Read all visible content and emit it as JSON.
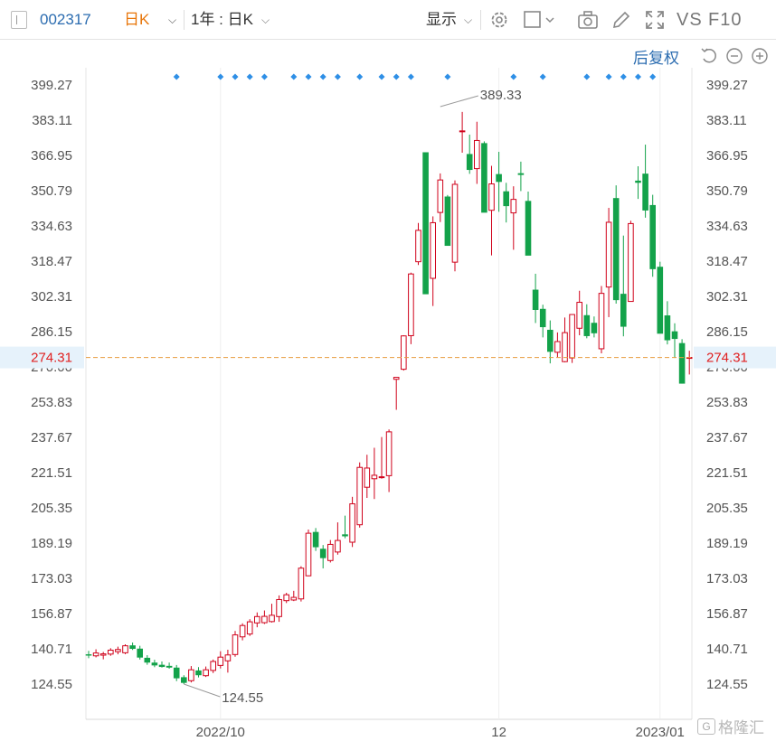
{
  "toolbar": {
    "stock_code": "002317",
    "period": "日K",
    "range": "1年 : 日K",
    "display": "显示",
    "vs": "VS",
    "f10": "F10",
    "adjust": "后复权"
  },
  "watermark": "格隆汇",
  "colors": {
    "up": "#d0021b",
    "down": "#13a24a",
    "price_line": "#e89b3c",
    "price_label_bg": "#e6f2fb",
    "price_label_text": "#e02020",
    "dot": "#2e8fe6"
  },
  "chart_data": {
    "type": "candlestick",
    "y_ticks": [
      "399.27",
      "383.11",
      "366.95",
      "350.79",
      "334.63",
      "318.47",
      "302.31",
      "286.15",
      "270.00",
      "253.83",
      "237.67",
      "221.51",
      "205.35",
      "189.19",
      "173.03",
      "156.87",
      "140.71",
      "124.55"
    ],
    "ylim": [
      116.47,
      407.35
    ],
    "x_tick_labels": [
      {
        "label": "2022/10",
        "index": 18
      },
      {
        "label": "12",
        "index": 56
      },
      {
        "label": "2023/01",
        "index": 78
      }
    ],
    "current_price": "274.31",
    "annotations": [
      {
        "label": "389.33",
        "index": 48,
        "value": 389.33,
        "side": "right"
      },
      {
        "label": "124.55",
        "index": 13,
        "value": 124.55,
        "side": "right-below"
      }
    ],
    "event_dot_indices": [
      12,
      18,
      20,
      22,
      24,
      28,
      30,
      32,
      34,
      37,
      40,
      42,
      44,
      49,
      58,
      62,
      68,
      71,
      73,
      75,
      77
    ],
    "candles": [
      {
        "o": 138.2,
        "h": 139.8,
        "l": 136.4,
        "c": 137.6
      },
      {
        "o": 137.5,
        "h": 140.5,
        "l": 136.8,
        "c": 138.8
      },
      {
        "o": 137.8,
        "h": 139.3,
        "l": 135.9,
        "c": 138.4
      },
      {
        "o": 138.3,
        "h": 141.0,
        "l": 137.5,
        "c": 140.1
      },
      {
        "o": 139.4,
        "h": 141.7,
        "l": 138.2,
        "c": 140.4
      },
      {
        "o": 138.9,
        "h": 142.8,
        "l": 138.3,
        "c": 142.1
      },
      {
        "o": 142.3,
        "h": 143.6,
        "l": 140.2,
        "c": 140.7
      },
      {
        "o": 140.8,
        "h": 142.1,
        "l": 135.8,
        "c": 136.7
      },
      {
        "o": 136.6,
        "h": 137.8,
        "l": 133.4,
        "c": 134.4
      },
      {
        "o": 134.4,
        "h": 135.7,
        "l": 132.3,
        "c": 133.1
      },
      {
        "o": 133.4,
        "h": 134.9,
        "l": 132.1,
        "c": 132.4
      },
      {
        "o": 132.9,
        "h": 134.4,
        "l": 131.6,
        "c": 132.1
      },
      {
        "o": 132.1,
        "h": 133.3,
        "l": 125.9,
        "c": 127.2
      },
      {
        "o": 127.7,
        "h": 128.6,
        "l": 124.55,
        "c": 125.1
      },
      {
        "o": 126.1,
        "h": 132.8,
        "l": 125.3,
        "c": 131.1
      },
      {
        "o": 130.8,
        "h": 132.3,
        "l": 127.6,
        "c": 128.6
      },
      {
        "o": 128.4,
        "h": 132.6,
        "l": 127.8,
        "c": 131.1
      },
      {
        "o": 130.8,
        "h": 135.8,
        "l": 129.6,
        "c": 134.9
      },
      {
        "o": 133.1,
        "h": 139.6,
        "l": 131.7,
        "c": 136.9
      },
      {
        "o": 135.2,
        "h": 140.3,
        "l": 129.8,
        "c": 137.9
      },
      {
        "o": 138.1,
        "h": 148.9,
        "l": 137.1,
        "c": 147.1
      },
      {
        "o": 146.2,
        "h": 152.4,
        "l": 144.6,
        "c": 151.4
      },
      {
        "o": 147.5,
        "h": 154.3,
        "l": 146.6,
        "c": 153.1
      },
      {
        "o": 152.6,
        "h": 157.4,
        "l": 150.6,
        "c": 155.5
      },
      {
        "o": 152.7,
        "h": 158.3,
        "l": 152.1,
        "c": 155.6
      },
      {
        "o": 153.2,
        "h": 161.4,
        "l": 152.8,
        "c": 156.1
      },
      {
        "o": 155.5,
        "h": 165.2,
        "l": 153.1,
        "c": 163.3
      },
      {
        "o": 162.8,
        "h": 166.4,
        "l": 161.7,
        "c": 165.5
      },
      {
        "o": 163.1,
        "h": 167.3,
        "l": 162.6,
        "c": 164.3
      },
      {
        "o": 163.6,
        "h": 178.6,
        "l": 162.4,
        "c": 177.7
      },
      {
        "o": 174.2,
        "h": 195.4,
        "l": 174.0,
        "c": 193.7
      },
      {
        "o": 194.3,
        "h": 196.1,
        "l": 185.6,
        "c": 187.3
      },
      {
        "o": 186.6,
        "h": 188.3,
        "l": 177.6,
        "c": 182.3
      },
      {
        "o": 181.2,
        "h": 190.6,
        "l": 180.3,
        "c": 188.6
      },
      {
        "o": 185.1,
        "h": 198.7,
        "l": 183.9,
        "c": 190.4
      },
      {
        "o": 193.2,
        "h": 201.8,
        "l": 191.4,
        "c": 192.3
      },
      {
        "o": 189.6,
        "h": 210.4,
        "l": 187.4,
        "c": 207.2
      },
      {
        "o": 197.6,
        "h": 226.2,
        "l": 196.3,
        "c": 223.9
      },
      {
        "o": 214.8,
        "h": 229.7,
        "l": 209.9,
        "c": 223.6
      },
      {
        "o": 218.7,
        "h": 232.9,
        "l": 209.4,
        "c": 220.3
      },
      {
        "o": 219.3,
        "h": 237.8,
        "l": 218.7,
        "c": 219.6
      },
      {
        "o": 220.1,
        "h": 241.3,
        "l": 212.6,
        "c": 240.2
      },
      {
        "o": 264.3,
        "h": 265.1,
        "l": 250.3,
        "c": 265.2
      },
      {
        "o": 268.9,
        "h": 284.5,
        "l": 268.3,
        "c": 284.2
      },
      {
        "o": 284.3,
        "h": 313.2,
        "l": 280.4,
        "c": 312.6
      },
      {
        "o": 318.2,
        "h": 336.0,
        "l": 316.7,
        "c": 332.6
      },
      {
        "o": 368.4,
        "h": 368.4,
        "l": 303.8,
        "c": 303.3
      },
      {
        "o": 310.6,
        "h": 339.0,
        "l": 297.9,
        "c": 336.1
      },
      {
        "o": 340.8,
        "h": 358.7,
        "l": 336.4,
        "c": 355.7
      },
      {
        "o": 348.1,
        "h": 348.8,
        "l": 334.3,
        "c": 325.5
      },
      {
        "o": 318.0,
        "h": 355.5,
        "l": 313.8,
        "c": 353.7
      },
      {
        "o": 378.1,
        "h": 386.9,
        "l": 368.2,
        "c": 378.2
      },
      {
        "o": 367.6,
        "h": 376.5,
        "l": 358.5,
        "c": 360.3
      },
      {
        "o": 360.9,
        "h": 382.4,
        "l": 353.9,
        "c": 373.8
      },
      {
        "o": 372.6,
        "h": 373.4,
        "l": 341.5,
        "c": 340.7
      },
      {
        "o": 341.8,
        "h": 362.2,
        "l": 321.1,
        "c": 353.9
      },
      {
        "o": 358.4,
        "h": 368.6,
        "l": 341.1,
        "c": 354.8
      },
      {
        "o": 350.5,
        "h": 354.4,
        "l": 336.2,
        "c": 343.7
      },
      {
        "o": 340.6,
        "h": 352.8,
        "l": 323.7,
        "c": 346.8
      },
      {
        "o": 358.8,
        "h": 364.1,
        "l": 350.6,
        "c": 358.0
      },
      {
        "o": 346.1,
        "h": 350.4,
        "l": 325.3,
        "c": 321.0
      },
      {
        "o": 305.4,
        "h": 312.7,
        "l": 290.1,
        "c": 296.1
      },
      {
        "o": 296.6,
        "h": 298.5,
        "l": 283.5,
        "c": 288.2
      },
      {
        "o": 287.0,
        "h": 291.3,
        "l": 271.6,
        "c": 276.9
      },
      {
        "o": 276.7,
        "h": 285.8,
        "l": 274.4,
        "c": 281.6
      },
      {
        "o": 272.4,
        "h": 292.6,
        "l": 272.1,
        "c": 285.7
      },
      {
        "o": 274.1,
        "h": 291.4,
        "l": 271.8,
        "c": 294.0
      },
      {
        "o": 287.7,
        "h": 304.9,
        "l": 284.5,
        "c": 299.6
      },
      {
        "o": 293.7,
        "h": 298.7,
        "l": 283.1,
        "c": 284.1
      },
      {
        "o": 290.2,
        "h": 293.1,
        "l": 283.5,
        "c": 285.4
      },
      {
        "o": 278.3,
        "h": 307.1,
        "l": 276.2,
        "c": 303.7
      },
      {
        "o": 306.6,
        "h": 342.9,
        "l": 292.8,
        "c": 336.3
      },
      {
        "o": 347.4,
        "h": 353.2,
        "l": 299.0,
        "c": 300.6
      },
      {
        "o": 303.5,
        "h": 330.2,
        "l": 284.0,
        "c": 288.4
      },
      {
        "o": 300.0,
        "h": 337.0,
        "l": 300.3,
        "c": 335.7
      },
      {
        "o": 355.4,
        "h": 362.0,
        "l": 347.0,
        "c": 354.4
      },
      {
        "o": 358.6,
        "h": 371.9,
        "l": 338.4,
        "c": 341.7
      },
      {
        "o": 344.2,
        "h": 348.9,
        "l": 311.3,
        "c": 314.8
      },
      {
        "o": 315.9,
        "h": 318.2,
        "l": 285.4,
        "c": 285.2
      },
      {
        "o": 293.6,
        "h": 300.1,
        "l": 280.3,
        "c": 282.2
      },
      {
        "o": 286.3,
        "h": 290.0,
        "l": 274.1,
        "c": 282.8
      },
      {
        "o": 280.9,
        "h": 282.7,
        "l": 262.3,
        "c": 262.3
      },
      {
        "o": 273.9,
        "h": 277.4,
        "l": 266.5,
        "c": 274.31
      }
    ]
  }
}
